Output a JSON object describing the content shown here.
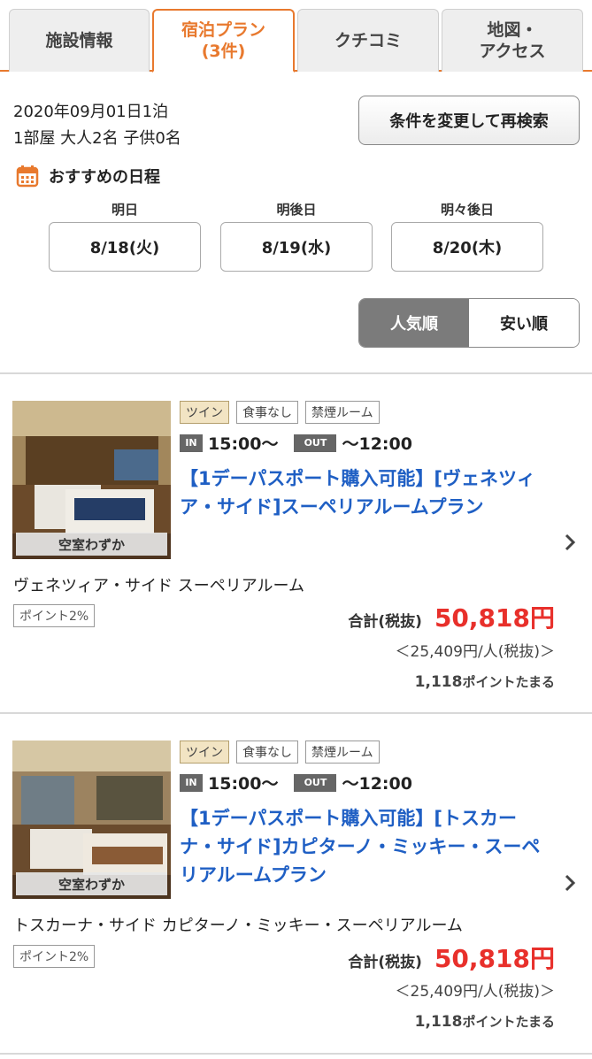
{
  "tabs": [
    {
      "label": "施設情報",
      "active": false
    },
    {
      "label": "宿泊プラン\n(3件)",
      "active": true
    },
    {
      "label": "クチコミ",
      "active": false
    },
    {
      "label": "地図・\nアクセス",
      "active": false
    }
  ],
  "search": {
    "date_line": "2020年09月01日1泊",
    "guests_line": "1部屋 大人2名 子供0名",
    "research_button": "条件を変更して再検索"
  },
  "recommended": {
    "title": "おすすめの日程",
    "dates": [
      {
        "day": "明日",
        "date": "8/18(火)"
      },
      {
        "day": "明後日",
        "date": "8/19(水)"
      },
      {
        "day": "明々後日",
        "date": "8/20(木)"
      }
    ]
  },
  "sort": {
    "options": [
      {
        "label": "人気順",
        "active": true
      },
      {
        "label": "安い順",
        "active": false
      }
    ]
  },
  "plans": [
    {
      "vacancy": "空室わずか",
      "tags": [
        "ツイン",
        "食事なし",
        "禁煙ルーム"
      ],
      "in_label": "IN",
      "checkin": "15:00〜",
      "out_label": "OUT",
      "checkout": "〜12:00",
      "title": "【1デーパスポート購入可能】[ヴェネツィア・サイド]スーペリアルームプラン",
      "room_name": "ヴェネツィア・サイド スーペリアルーム",
      "point_rate": "ポイント2%",
      "total_label": "合計(税抜)",
      "total_price": "50,818円",
      "per_person": "＜25,409円/人(税抜)＞",
      "points_num": "1,118",
      "points_text": "ポイントたまる"
    },
    {
      "vacancy": "空室わずか",
      "tags": [
        "ツイン",
        "食事なし",
        "禁煙ルーム"
      ],
      "in_label": "IN",
      "checkin": "15:00〜",
      "out_label": "OUT",
      "checkout": "〜12:00",
      "title": "【1デーパスポート購入可能】[トスカーナ・サイド]カピターノ・ミッキー・スーペリアルームプラン",
      "room_name": "トスカーナ・サイド カピターノ・ミッキー・スーペリアルーム",
      "point_rate": "ポイント2%",
      "total_label": "合計(税抜)",
      "total_price": "50,818円",
      "per_person": "＜25,409円/人(税抜)＞",
      "points_num": "1,118",
      "points_text": "ポイントたまる"
    }
  ],
  "colors": {
    "accent": "#e8792e",
    "link": "#1f5fc4",
    "price": "#e8302b"
  }
}
